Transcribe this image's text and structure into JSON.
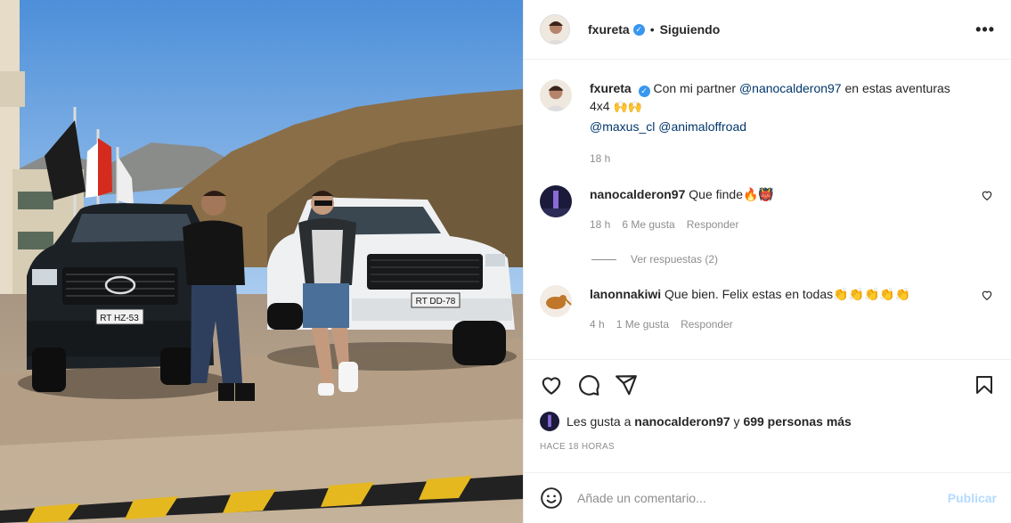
{
  "post": {
    "author": "fxureta",
    "follow_status": "Siguiendo",
    "separator": "•",
    "more_label": "•••"
  },
  "caption": {
    "user": "fxureta",
    "text_before": "Con mi partner",
    "mention_1": "@nanocalderon97",
    "text_after": "en estas aventuras 4x4",
    "emoji": "🙌🙌",
    "mention_2": "@maxus_cl",
    "mention_3": "@animaloffroad",
    "time": "18 h"
  },
  "comments": [
    {
      "user": "nanocalderon97",
      "text": "Que finde🔥👹",
      "time": "18 h",
      "likes": "6 Me gusta",
      "reply": "Responder",
      "view_replies": "Ver respuestas (2)"
    },
    {
      "user": "lanonnakiwi",
      "text": "Que bien. Felix estas en todas👏👏👏👏👏",
      "time": "4 h",
      "likes": "1 Me gusta",
      "reply": "Responder"
    }
  ],
  "likes": {
    "prefix": "Les gusta a",
    "user": "nanocalderon97",
    "joiner": "y",
    "others": "699 personas más"
  },
  "timestamp": "HACE 18 HORAS",
  "comment_box": {
    "placeholder": "Añade un comentario...",
    "publish": "Publicar"
  },
  "photo": {
    "plate_left": "RT HZ-53",
    "plate_right": "RT DD-78"
  },
  "colors": {
    "link": "#00376b",
    "verified": "#3897f0",
    "publish_disabled": "#b3dbff",
    "meta": "#8e8e8e"
  },
  "icons": [
    "heart-icon",
    "comment-icon",
    "share-icon",
    "bookmark-icon",
    "emoji-icon",
    "verified-icon"
  ]
}
